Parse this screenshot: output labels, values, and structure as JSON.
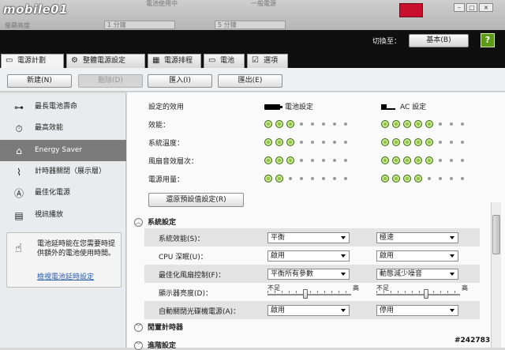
{
  "watermark": "mobile01",
  "background_window": {
    "items": [
      "電池使用中",
      "一般電源"
    ],
    "dim_label": "螢幕亮度",
    "dim_value": "1 分鐘",
    "sleep_value": "5 分鐘"
  },
  "header": {
    "switch_label": "切換至：",
    "switch_button": "基本(B)",
    "help_label": "?"
  },
  "tabs": [
    {
      "label": "電源計劃",
      "icon": "document-icon",
      "glyph": "▭"
    },
    {
      "label": "整體電源設定",
      "icon": "gear-icon",
      "glyph": "⚙"
    },
    {
      "label": "電源排程",
      "icon": "calendar-icon",
      "glyph": "▦"
    },
    {
      "label": "電池",
      "icon": "battery-icon",
      "glyph": "▭"
    },
    {
      "label": "選項",
      "icon": "checkbox-icon",
      "glyph": "☑"
    }
  ],
  "toolbar": {
    "new": "新建(N)",
    "delete": "刪除(D)",
    "import": "匯入(I)",
    "export": "匯出(E)"
  },
  "sidebar": {
    "items": [
      {
        "label": "最長電池壽命",
        "icon": "long-battery-icon",
        "glyph": "⊶"
      },
      {
        "label": "最高效能",
        "icon": "stopwatch-icon",
        "glyph": "⏱"
      },
      {
        "label": "Energy Saver",
        "icon": "home-icon",
        "glyph": "⌂"
      },
      {
        "label": "計時器關閉（展示層）",
        "icon": "timer-off-icon",
        "glyph": "⌇"
      },
      {
        "label": "最佳化電源",
        "icon": "letter-a-icon",
        "glyph": "Ⓐ"
      },
      {
        "label": "視訊播放",
        "icon": "film-icon",
        "glyph": "▤"
      }
    ],
    "info_text": "電池延時能在您需要時提供額外的電池使用時間。",
    "info_link": "檢視電池延時設定"
  },
  "main": {
    "header_label": "設定的效用",
    "battery_header": "電池設定",
    "ac_header": "AC 設定",
    "rows": [
      {
        "label": "效能：",
        "battery": 3,
        "ac": 5
      },
      {
        "label": "系統溫度：",
        "battery": 3,
        "ac": 5
      },
      {
        "label": "風扇音效層次：",
        "battery": 3,
        "ac": 5
      },
      {
        "label": "電源用量：",
        "battery": 2,
        "ac": 4
      }
    ],
    "dots_total": 8,
    "restore_button": "還原預設值設定(R)"
  },
  "system_settings": {
    "title": "系統設定",
    "settings": [
      {
        "label": "系統效能(S)：",
        "battery": "平衡",
        "ac": "極速",
        "type": "select"
      },
      {
        "label": "CPU 深眠(U)：",
        "battery": "啟用",
        "ac": "啟用",
        "type": "select"
      },
      {
        "label": "最佳化風扇控制(F)：",
        "battery": "平衡所有參數",
        "ac": "動態減少噪音",
        "type": "select"
      },
      {
        "label": "顯示器亮度(D)：",
        "type": "slider",
        "low": "不足",
        "high": "高",
        "battery_level": 0.45,
        "ac_level": 0.6
      },
      {
        "label": "自動關閉光碟機電源(A)：",
        "battery": "啟用",
        "ac": "停用",
        "type": "select"
      }
    ],
    "timer_section": "閒置計時器",
    "advanced_section": "進階設定"
  },
  "stamp": "#242783"
}
